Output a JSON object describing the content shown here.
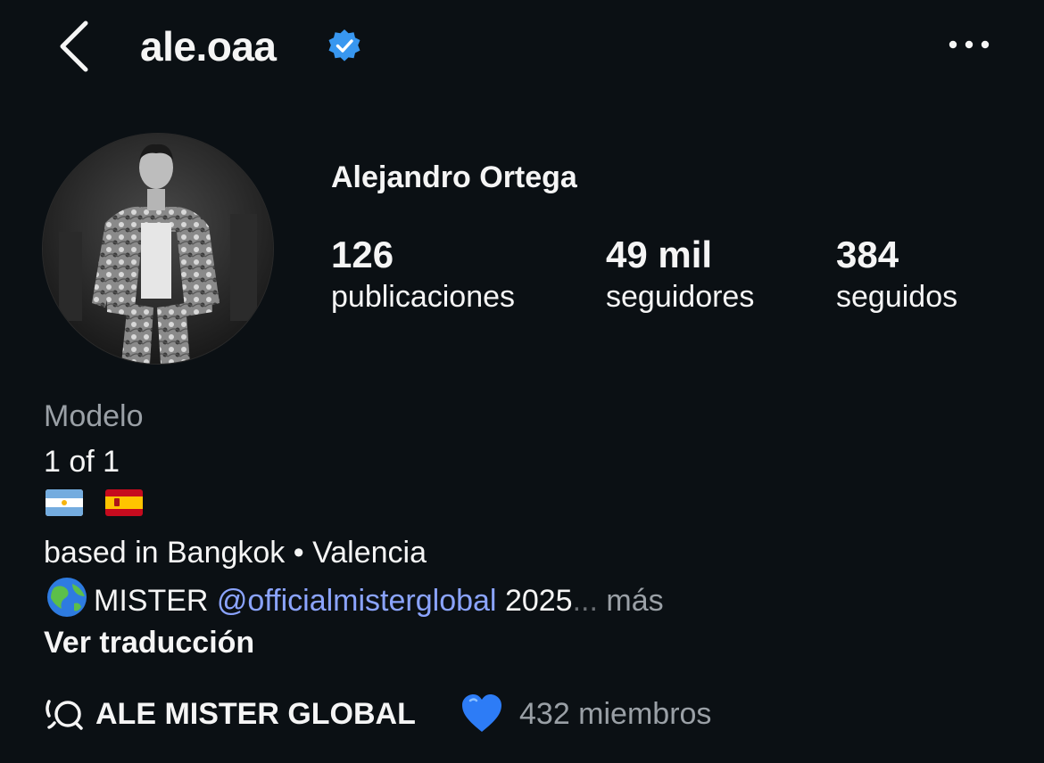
{
  "header": {
    "username": "ale.oaa",
    "back_icon": "chevron-left-icon",
    "verified_icon": "verified-badge-icon",
    "more_icon": "more-dots-icon",
    "verified_color": "#3897f0"
  },
  "profile": {
    "full_name": "Alejandro Ortega",
    "avatar": "profile-photo",
    "stats": [
      {
        "value": "126",
        "label": "publicaciones"
      },
      {
        "value": "49 mil",
        "label": "seguidores"
      },
      {
        "value": "384",
        "label": "seguidos"
      }
    ]
  },
  "bio": {
    "category": "Modelo",
    "line1": "1 of 1",
    "flags": [
      "argentina-flag",
      "spain-flag"
    ],
    "location_prefix": "based in Bangkok",
    "location_separator": " • ",
    "location_city": "Valencia",
    "globe_icon": "globe-icon",
    "mister_text": "MISTER",
    "mention": "@officialmisterglobal",
    "year": "2025",
    "ellipsis": "...",
    "more_label": "más",
    "translate_label": "Ver traducción"
  },
  "channel": {
    "icon": "broadcast-channel-icon",
    "name": "ALE MISTER GLOBAL",
    "heart_icon": "blue-heart-icon",
    "heart_color": "#2d7cf6",
    "members": "432 miembros"
  }
}
